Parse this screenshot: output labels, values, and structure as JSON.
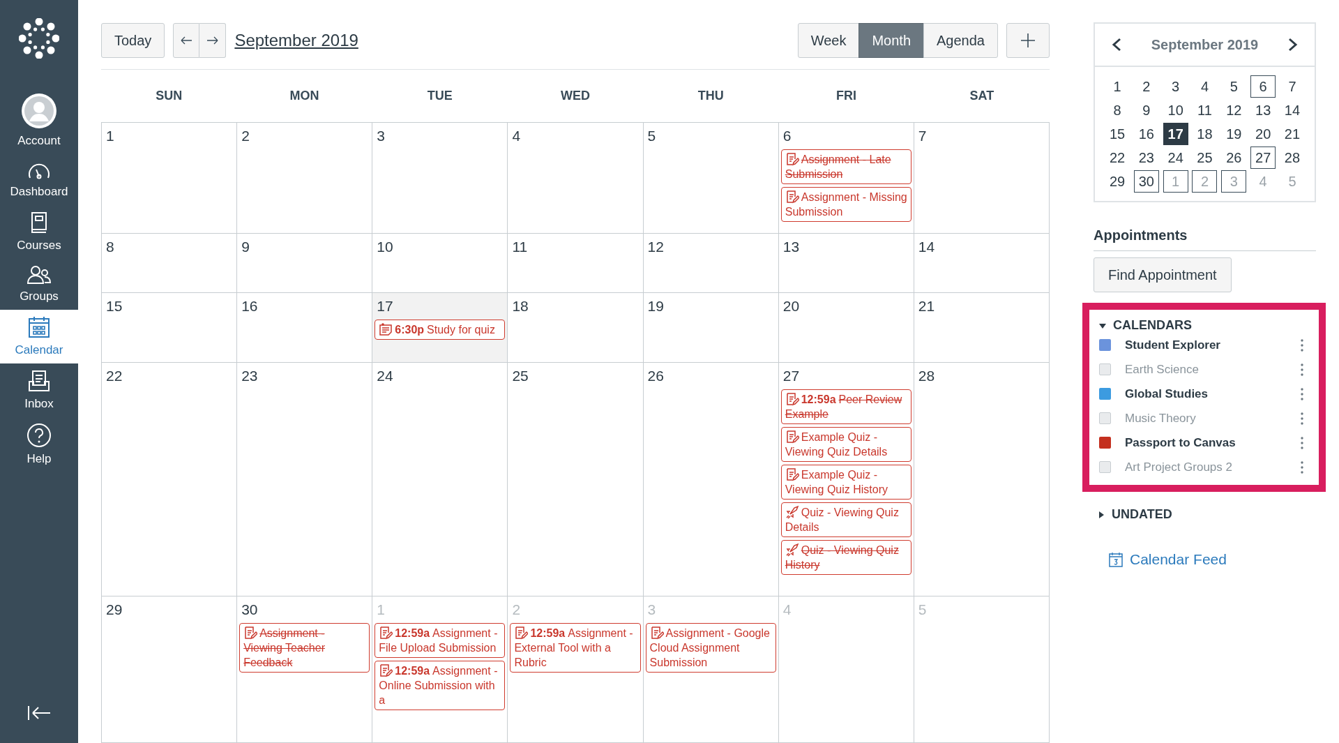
{
  "nav": {
    "items": [
      {
        "kind": "account",
        "label": "Account",
        "selected": false
      },
      {
        "kind": "dashboard",
        "label": "Dashboard",
        "selected": false
      },
      {
        "kind": "courses",
        "label": "Courses",
        "selected": false
      },
      {
        "kind": "groups",
        "label": "Groups",
        "selected": false
      },
      {
        "kind": "calendar",
        "label": "Calendar",
        "selected": true
      },
      {
        "kind": "inbox",
        "label": "Inbox",
        "selected": false
      },
      {
        "kind": "help",
        "label": "Help",
        "selected": false
      }
    ]
  },
  "toolbar": {
    "today": "Today",
    "title": "September 2019",
    "views": [
      {
        "label": "Week",
        "selected": false
      },
      {
        "label": "Month",
        "selected": true
      },
      {
        "label": "Agenda",
        "selected": false
      }
    ]
  },
  "weekdays": [
    "SUN",
    "MON",
    "TUE",
    "WED",
    "THU",
    "FRI",
    "SAT"
  ],
  "weeks": [
    {
      "days": [
        {
          "day": "1",
          "today": false,
          "outside": false
        },
        {
          "day": "2",
          "today": false,
          "outside": false
        },
        {
          "day": "3",
          "today": false,
          "outside": false
        },
        {
          "day": "4",
          "today": false,
          "outside": false
        },
        {
          "day": "5",
          "today": false,
          "outside": false
        },
        {
          "day": "6",
          "today": false,
          "outside": false,
          "events": [
            {
              "kind": "assignment",
              "title": "Assignment - Late Submission",
              "struck": true
            },
            {
              "kind": "assignment",
              "title": "Assignment - Missing Submission",
              "struck": false
            }
          ]
        },
        {
          "day": "7",
          "today": false,
          "outside": false
        }
      ]
    },
    {
      "days": [
        {
          "day": "8",
          "today": false,
          "outside": false
        },
        {
          "day": "9",
          "today": false,
          "outside": false
        },
        {
          "day": "10",
          "today": false,
          "outside": false
        },
        {
          "day": "11",
          "today": false,
          "outside": false
        },
        {
          "day": "12",
          "today": false,
          "outside": false
        },
        {
          "day": "13",
          "today": false,
          "outside": false
        },
        {
          "day": "14",
          "today": false,
          "outside": false
        }
      ]
    },
    {
      "days": [
        {
          "day": "15",
          "today": false,
          "outside": false
        },
        {
          "day": "16",
          "today": false,
          "outside": false
        },
        {
          "day": "17",
          "today": true,
          "outside": false,
          "events": [
            {
              "kind": "note",
              "time": "6:30p",
              "title": "Study for quiz",
              "struck": false
            }
          ]
        },
        {
          "day": "18",
          "today": false,
          "outside": false
        },
        {
          "day": "19",
          "today": false,
          "outside": false
        },
        {
          "day": "20",
          "today": false,
          "outside": false
        },
        {
          "day": "21",
          "today": false,
          "outside": false
        }
      ]
    },
    {
      "days": [
        {
          "day": "22",
          "today": false,
          "outside": false
        },
        {
          "day": "23",
          "today": false,
          "outside": false
        },
        {
          "day": "24",
          "today": false,
          "outside": false
        },
        {
          "day": "25",
          "today": false,
          "outside": false
        },
        {
          "day": "26",
          "today": false,
          "outside": false
        },
        {
          "day": "27",
          "today": false,
          "outside": false,
          "events": [
            {
              "kind": "assignment",
              "time": "12:59a",
              "title": "Peer Review Example",
              "struck": true
            },
            {
              "kind": "assignment",
              "title": "Example Quiz - Viewing Quiz Details",
              "struck": false
            },
            {
              "kind": "assignment",
              "title": "Example Quiz - Viewing Quiz History",
              "struck": false
            },
            {
              "kind": "quiz",
              "title": "Quiz - Viewing Quiz Details",
              "struck": false
            },
            {
              "kind": "quiz",
              "title": "Quiz - Viewing Quiz History",
              "struck": true
            }
          ]
        },
        {
          "day": "28",
          "today": false,
          "outside": false
        }
      ]
    },
    {
      "days": [
        {
          "day": "29",
          "today": false,
          "outside": false
        },
        {
          "day": "30",
          "today": false,
          "outside": false,
          "events": [
            {
              "kind": "assignment",
              "title": "Assignment - Viewing Teacher Feedback",
              "struck": true
            }
          ]
        },
        {
          "day": "1",
          "today": false,
          "outside": true,
          "events": [
            {
              "kind": "assignment",
              "time": "12:59a",
              "title": "Assignment - File Upload Submission",
              "struck": false
            },
            {
              "kind": "assignment",
              "time": "12:59a",
              "title": "Assignment - Online Submission with a",
              "struck": false
            }
          ]
        },
        {
          "day": "2",
          "today": false,
          "outside": true,
          "events": [
            {
              "kind": "assignment",
              "time": "12:59a",
              "title": "Assignment - External Tool with a Rubric",
              "struck": false
            }
          ]
        },
        {
          "day": "3",
          "today": false,
          "outside": true,
          "events": [
            {
              "kind": "assignment",
              "title": "Assignment - Google Cloud Assignment Submission",
              "struck": false
            }
          ]
        },
        {
          "day": "4",
          "today": false,
          "outside": true
        },
        {
          "day": "5",
          "today": false,
          "outside": true
        }
      ]
    }
  ],
  "mini_calendar": {
    "title": "September 2019",
    "days": [
      {
        "label": "1",
        "marked": false,
        "today": false,
        "outside": false
      },
      {
        "label": "2",
        "marked": false,
        "today": false,
        "outside": false
      },
      {
        "label": "3",
        "marked": false,
        "today": false,
        "outside": false
      },
      {
        "label": "4",
        "marked": false,
        "today": false,
        "outside": false
      },
      {
        "label": "5",
        "marked": false,
        "today": false,
        "outside": false
      },
      {
        "label": "6",
        "marked": true,
        "today": false,
        "outside": false
      },
      {
        "label": "7",
        "marked": false,
        "today": false,
        "outside": false
      },
      {
        "label": "8",
        "marked": false,
        "today": false,
        "outside": false
      },
      {
        "label": "9",
        "marked": false,
        "today": false,
        "outside": false
      },
      {
        "label": "10",
        "marked": false,
        "today": false,
        "outside": false
      },
      {
        "label": "11",
        "marked": false,
        "today": false,
        "outside": false
      },
      {
        "label": "12",
        "marked": false,
        "today": false,
        "outside": false
      },
      {
        "label": "13",
        "marked": false,
        "today": false,
        "outside": false
      },
      {
        "label": "14",
        "marked": false,
        "today": false,
        "outside": false
      },
      {
        "label": "15",
        "marked": false,
        "today": false,
        "outside": false
      },
      {
        "label": "16",
        "marked": false,
        "today": false,
        "outside": false
      },
      {
        "label": "17",
        "marked": false,
        "today": true,
        "outside": false
      },
      {
        "label": "18",
        "marked": false,
        "today": false,
        "outside": false
      },
      {
        "label": "19",
        "marked": false,
        "today": false,
        "outside": false
      },
      {
        "label": "20",
        "marked": false,
        "today": false,
        "outside": false
      },
      {
        "label": "21",
        "marked": false,
        "today": false,
        "outside": false
      },
      {
        "label": "22",
        "marked": false,
        "today": false,
        "outside": false
      },
      {
        "label": "23",
        "marked": false,
        "today": false,
        "outside": false
      },
      {
        "label": "24",
        "marked": false,
        "today": false,
        "outside": false
      },
      {
        "label": "25",
        "marked": false,
        "today": false,
        "outside": false
      },
      {
        "label": "26",
        "marked": false,
        "today": false,
        "outside": false
      },
      {
        "label": "27",
        "marked": true,
        "today": false,
        "outside": false
      },
      {
        "label": "28",
        "marked": false,
        "today": false,
        "outside": false
      },
      {
        "label": "29",
        "marked": false,
        "today": false,
        "outside": false
      },
      {
        "label": "30",
        "marked": true,
        "today": false,
        "outside": false
      },
      {
        "label": "1",
        "marked": true,
        "today": false,
        "outside": true
      },
      {
        "label": "2",
        "marked": true,
        "today": false,
        "outside": true
      },
      {
        "label": "3",
        "marked": true,
        "today": false,
        "outside": true
      },
      {
        "label": "4",
        "marked": false,
        "today": false,
        "outside": true
      },
      {
        "label": "5",
        "marked": false,
        "today": false,
        "outside": true
      }
    ]
  },
  "appointments": {
    "heading": "Appointments",
    "button": "Find Appointment"
  },
  "calendars": {
    "heading": "CALENDARS",
    "expanded": true,
    "items": [
      {
        "name": "Student Explorer",
        "checked": true,
        "color": "#6b93dc"
      },
      {
        "name": "Earth Science",
        "checked": false
      },
      {
        "name": "Global Studies",
        "checked": true,
        "color": "#3c9be0"
      },
      {
        "name": "Music Theory",
        "checked": false
      },
      {
        "name": "Passport to Canvas",
        "checked": true,
        "color": "#c4301f"
      },
      {
        "name": "Art Project Groups 2",
        "checked": false
      }
    ]
  },
  "undated": {
    "label": "UNDATED",
    "expanded": false
  },
  "feed_link": "Calendar Feed"
}
